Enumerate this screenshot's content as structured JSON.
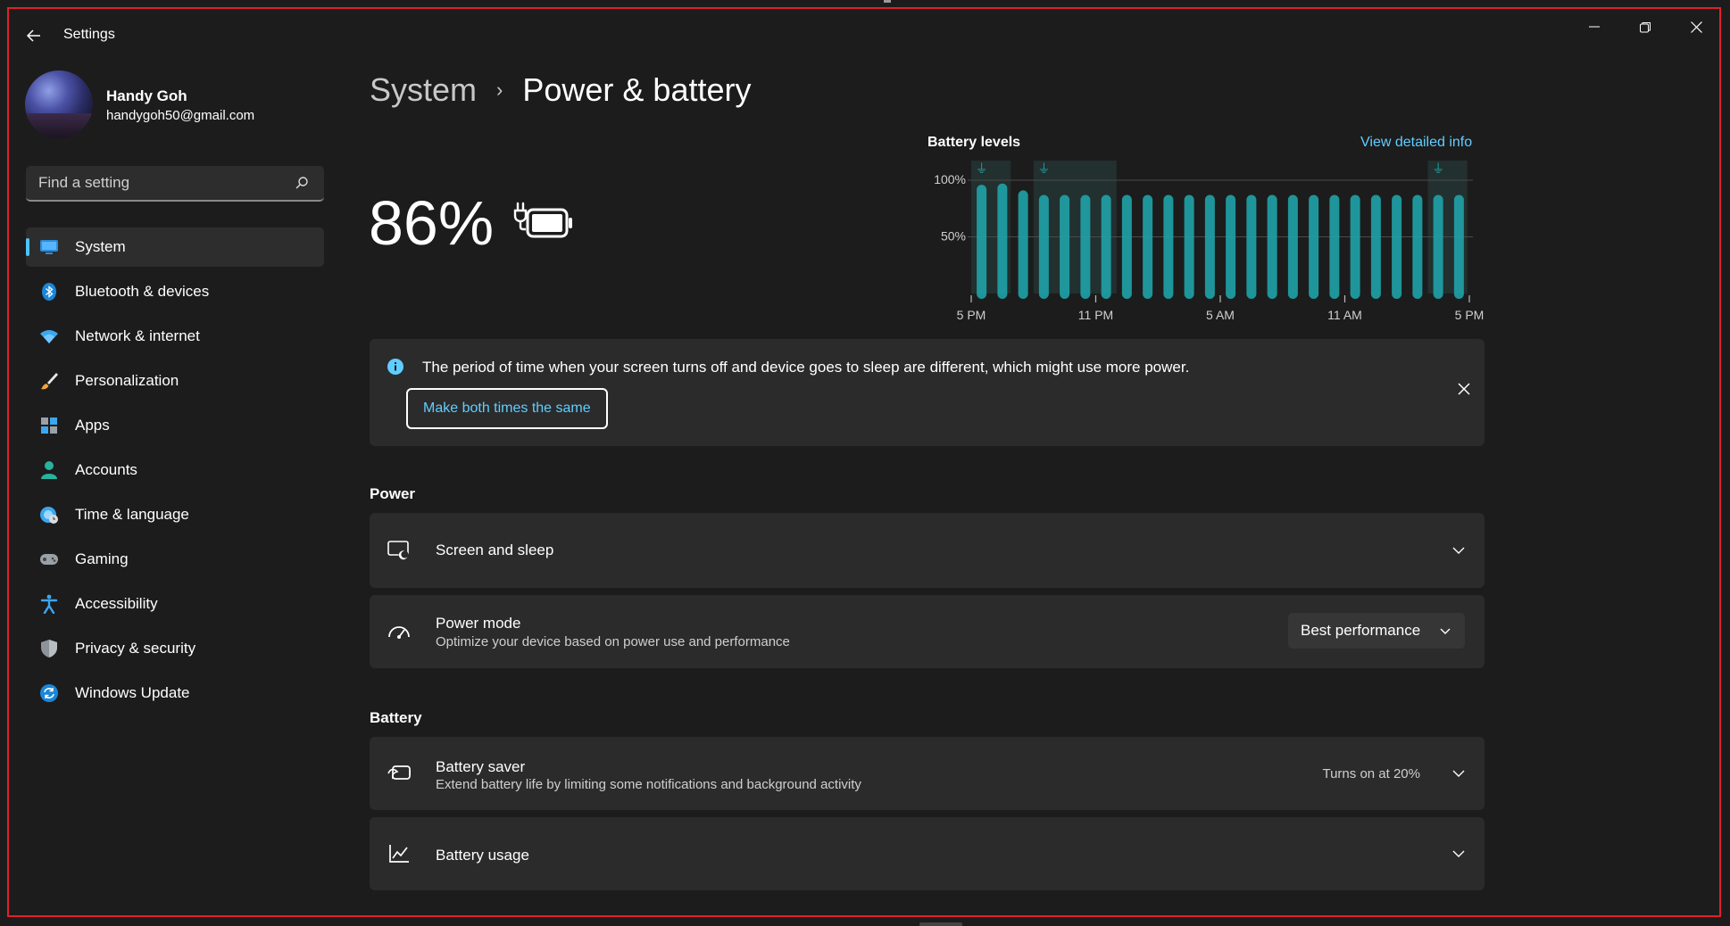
{
  "window": {
    "title": "Settings"
  },
  "user": {
    "name": "Handy Goh",
    "email": "handygoh50@gmail.com"
  },
  "search": {
    "placeholder": "Find a setting"
  },
  "nav": [
    {
      "label": "System",
      "icon": "system-icon",
      "active": true
    },
    {
      "label": "Bluetooth & devices",
      "icon": "bluetooth-icon"
    },
    {
      "label": "Network & internet",
      "icon": "wifi-icon"
    },
    {
      "label": "Personalization",
      "icon": "brush-icon"
    },
    {
      "label": "Apps",
      "icon": "apps-icon"
    },
    {
      "label": "Accounts",
      "icon": "person-icon"
    },
    {
      "label": "Time & language",
      "icon": "globe-clock-icon"
    },
    {
      "label": "Gaming",
      "icon": "gamepad-icon"
    },
    {
      "label": "Accessibility",
      "icon": "accessibility-icon"
    },
    {
      "label": "Privacy & security",
      "icon": "shield-icon"
    },
    {
      "label": "Windows Update",
      "icon": "update-icon"
    }
  ],
  "breadcrumb": {
    "parent": "System",
    "separator": "›",
    "current": "Power & battery"
  },
  "battery": {
    "percent": "86%"
  },
  "chart_data": {
    "type": "bar",
    "title": "Battery levels",
    "link": "View detailed info",
    "ylim": [
      0,
      100
    ],
    "y_ticks": [
      "100%",
      "50%"
    ],
    "x_ticks": [
      "5 PM",
      "11 PM",
      "5 AM",
      "11 AM",
      "5 PM"
    ],
    "values": [
      96,
      97,
      91,
      87,
      87,
      87,
      87,
      87,
      87,
      87,
      87,
      87,
      87,
      87,
      87,
      87,
      87,
      87,
      87,
      87,
      87,
      87,
      87,
      87
    ],
    "charging_marker_bars": [
      0,
      3,
      22
    ],
    "grid": true,
    "bar_color": "#1fa3a8"
  },
  "info": {
    "text": "The period of time when your screen turns off and device goes to sleep are different, which might use more power.",
    "button": "Make both times the same"
  },
  "power": {
    "heading": "Power",
    "screen_sleep": {
      "title": "Screen and sleep"
    },
    "power_mode": {
      "title": "Power mode",
      "subtitle": "Optimize your device based on power use and performance",
      "value": "Best performance"
    }
  },
  "battery_section": {
    "heading": "Battery",
    "saver": {
      "title": "Battery saver",
      "subtitle": "Extend battery life by limiting some notifications and background activity",
      "status": "Turns on at 20%"
    },
    "usage": {
      "title": "Battery usage"
    }
  },
  "colors": {
    "accent": "#60cdff",
    "chart_bar": "#1fa3a8",
    "card": "#2b2b2b",
    "background": "#1c1c1c"
  }
}
